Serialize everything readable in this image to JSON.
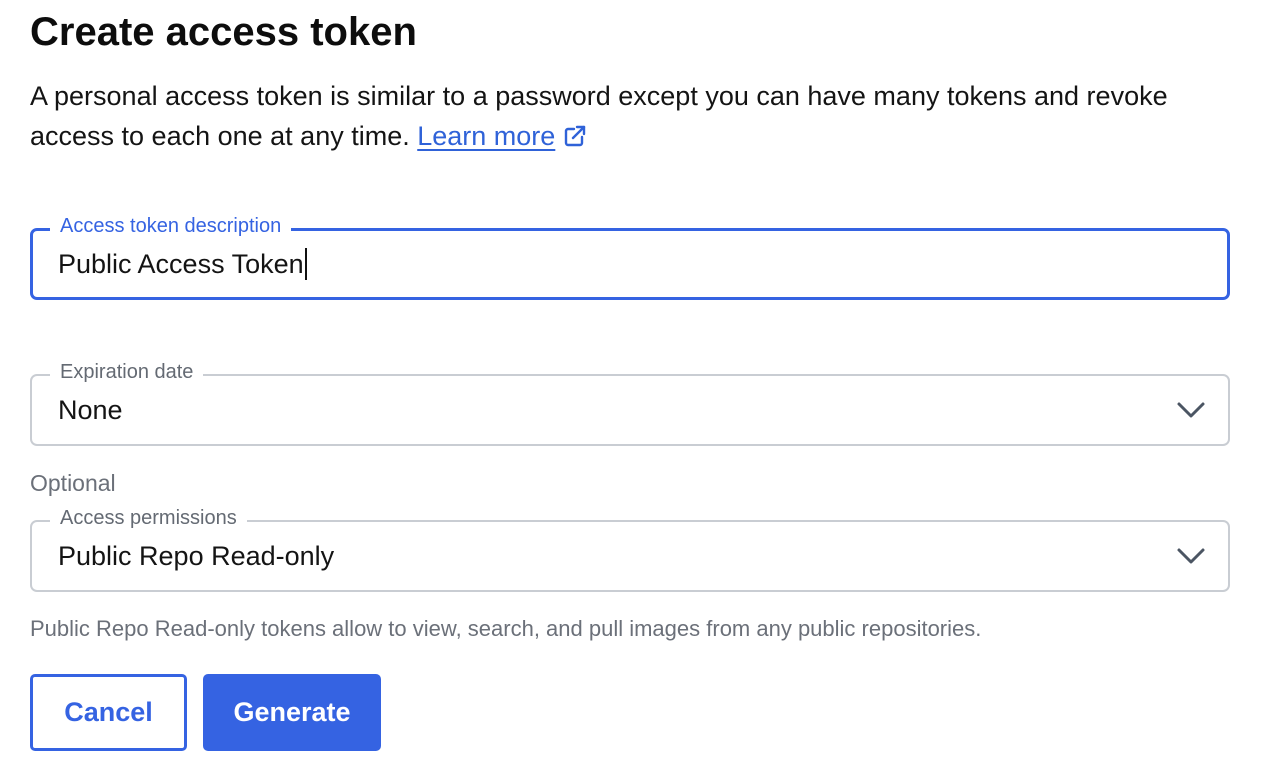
{
  "header": {
    "title": "Create access token"
  },
  "intro": {
    "text": "A personal access token is similar to a password except you can have many tokens and revoke access to each one at any time.",
    "link_label": "Learn more",
    "link_icon": "external-link-icon"
  },
  "form": {
    "description": {
      "label": "Access token description",
      "value": "Public Access Token"
    },
    "expiration": {
      "label": "Expiration date",
      "value": "None",
      "icon": "chevron-down-icon"
    },
    "optional_label": "Optional",
    "permissions": {
      "label": "Access permissions",
      "value": "Public Repo Read-only",
      "icon": "chevron-down-icon",
      "helper": "Public Repo Read-only tokens allow to view, search, and pull images from any public repositories."
    }
  },
  "actions": {
    "cancel_label": "Cancel",
    "generate_label": "Generate"
  },
  "colors": {
    "accent": "#3563e2",
    "link": "#2f62d8",
    "muted_text": "#6b7079",
    "border": "#c9cdd3"
  }
}
